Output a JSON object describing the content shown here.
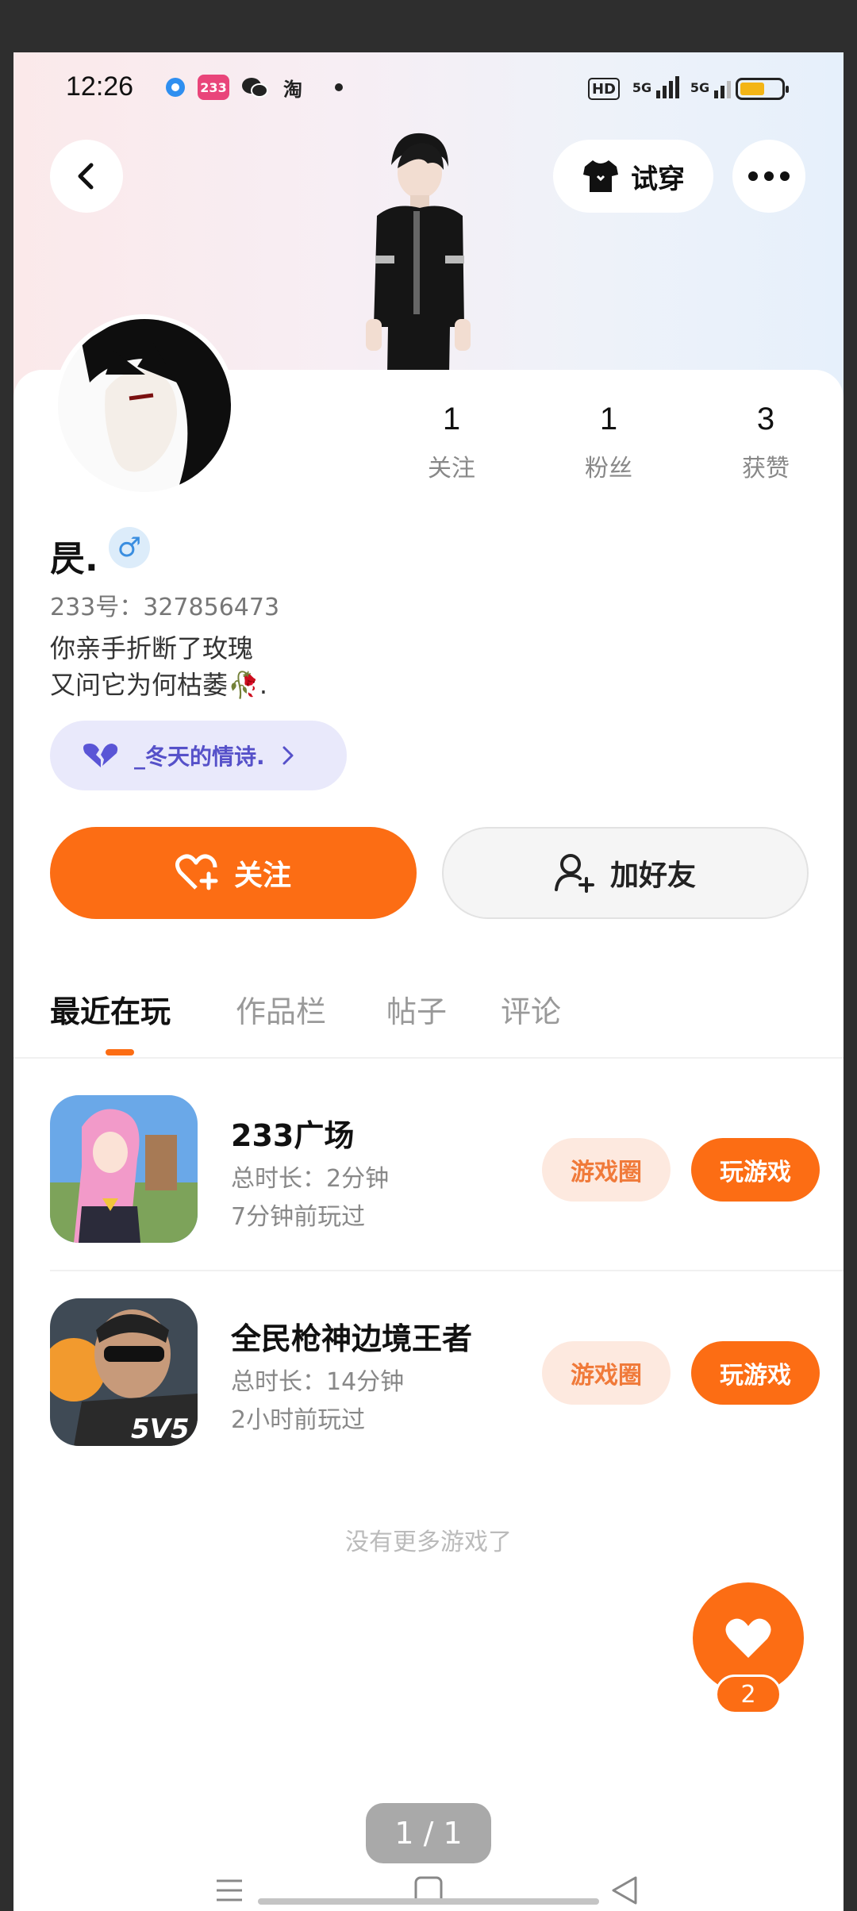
{
  "status_bar": {
    "time": "12:26",
    "app_badge": "233",
    "taobao": "淘",
    "signal_1": "5G",
    "signal_2": "5G",
    "hd": "HD"
  },
  "header": {
    "back_icon": "chevron-left-icon",
    "try_on_label": "试穿",
    "more_icon": "more-dots-icon"
  },
  "profile": {
    "name": "昃.",
    "gender_symbol": "♂",
    "uid": "233号：327856473",
    "bio": "你亲手折断了玫瑰\n又问它为何枯萎🥀.",
    "stats": [
      {
        "value": "1",
        "label": "关注"
      },
      {
        "value": "1",
        "label": "粉丝"
      },
      {
        "value": "3",
        "label": "获赞"
      }
    ],
    "relationship_pill": "_冬天的情诗.",
    "follow_label": "关注",
    "add_friend_label": "加好友"
  },
  "tabs": [
    {
      "label": "最近在玩",
      "active": true
    },
    {
      "label": "作品栏",
      "active": false
    },
    {
      "label": "帖子",
      "active": false
    },
    {
      "label": "评论",
      "active": false
    }
  ],
  "games": [
    {
      "title": "233广场",
      "total_time": "总时长：2分钟",
      "last_played": "7分钟前玩过",
      "circle_label": "游戏圈",
      "play_label": "玩游戏"
    },
    {
      "title": "全民枪神边境王者",
      "total_time": "总时长：14分钟",
      "last_played": "2小时前玩过",
      "circle_label": "游戏圈",
      "play_label": "玩游戏",
      "icon_text": "5V5"
    }
  ],
  "no_more_text": "没有更多游戏了",
  "like_count": "2",
  "page_indicator": "1 / 1",
  "colors": {
    "accent": "#fc6d14",
    "accent_light": "#fde9df",
    "pill_bg": "#e9e9fb",
    "pill_text": "#5651c9"
  }
}
